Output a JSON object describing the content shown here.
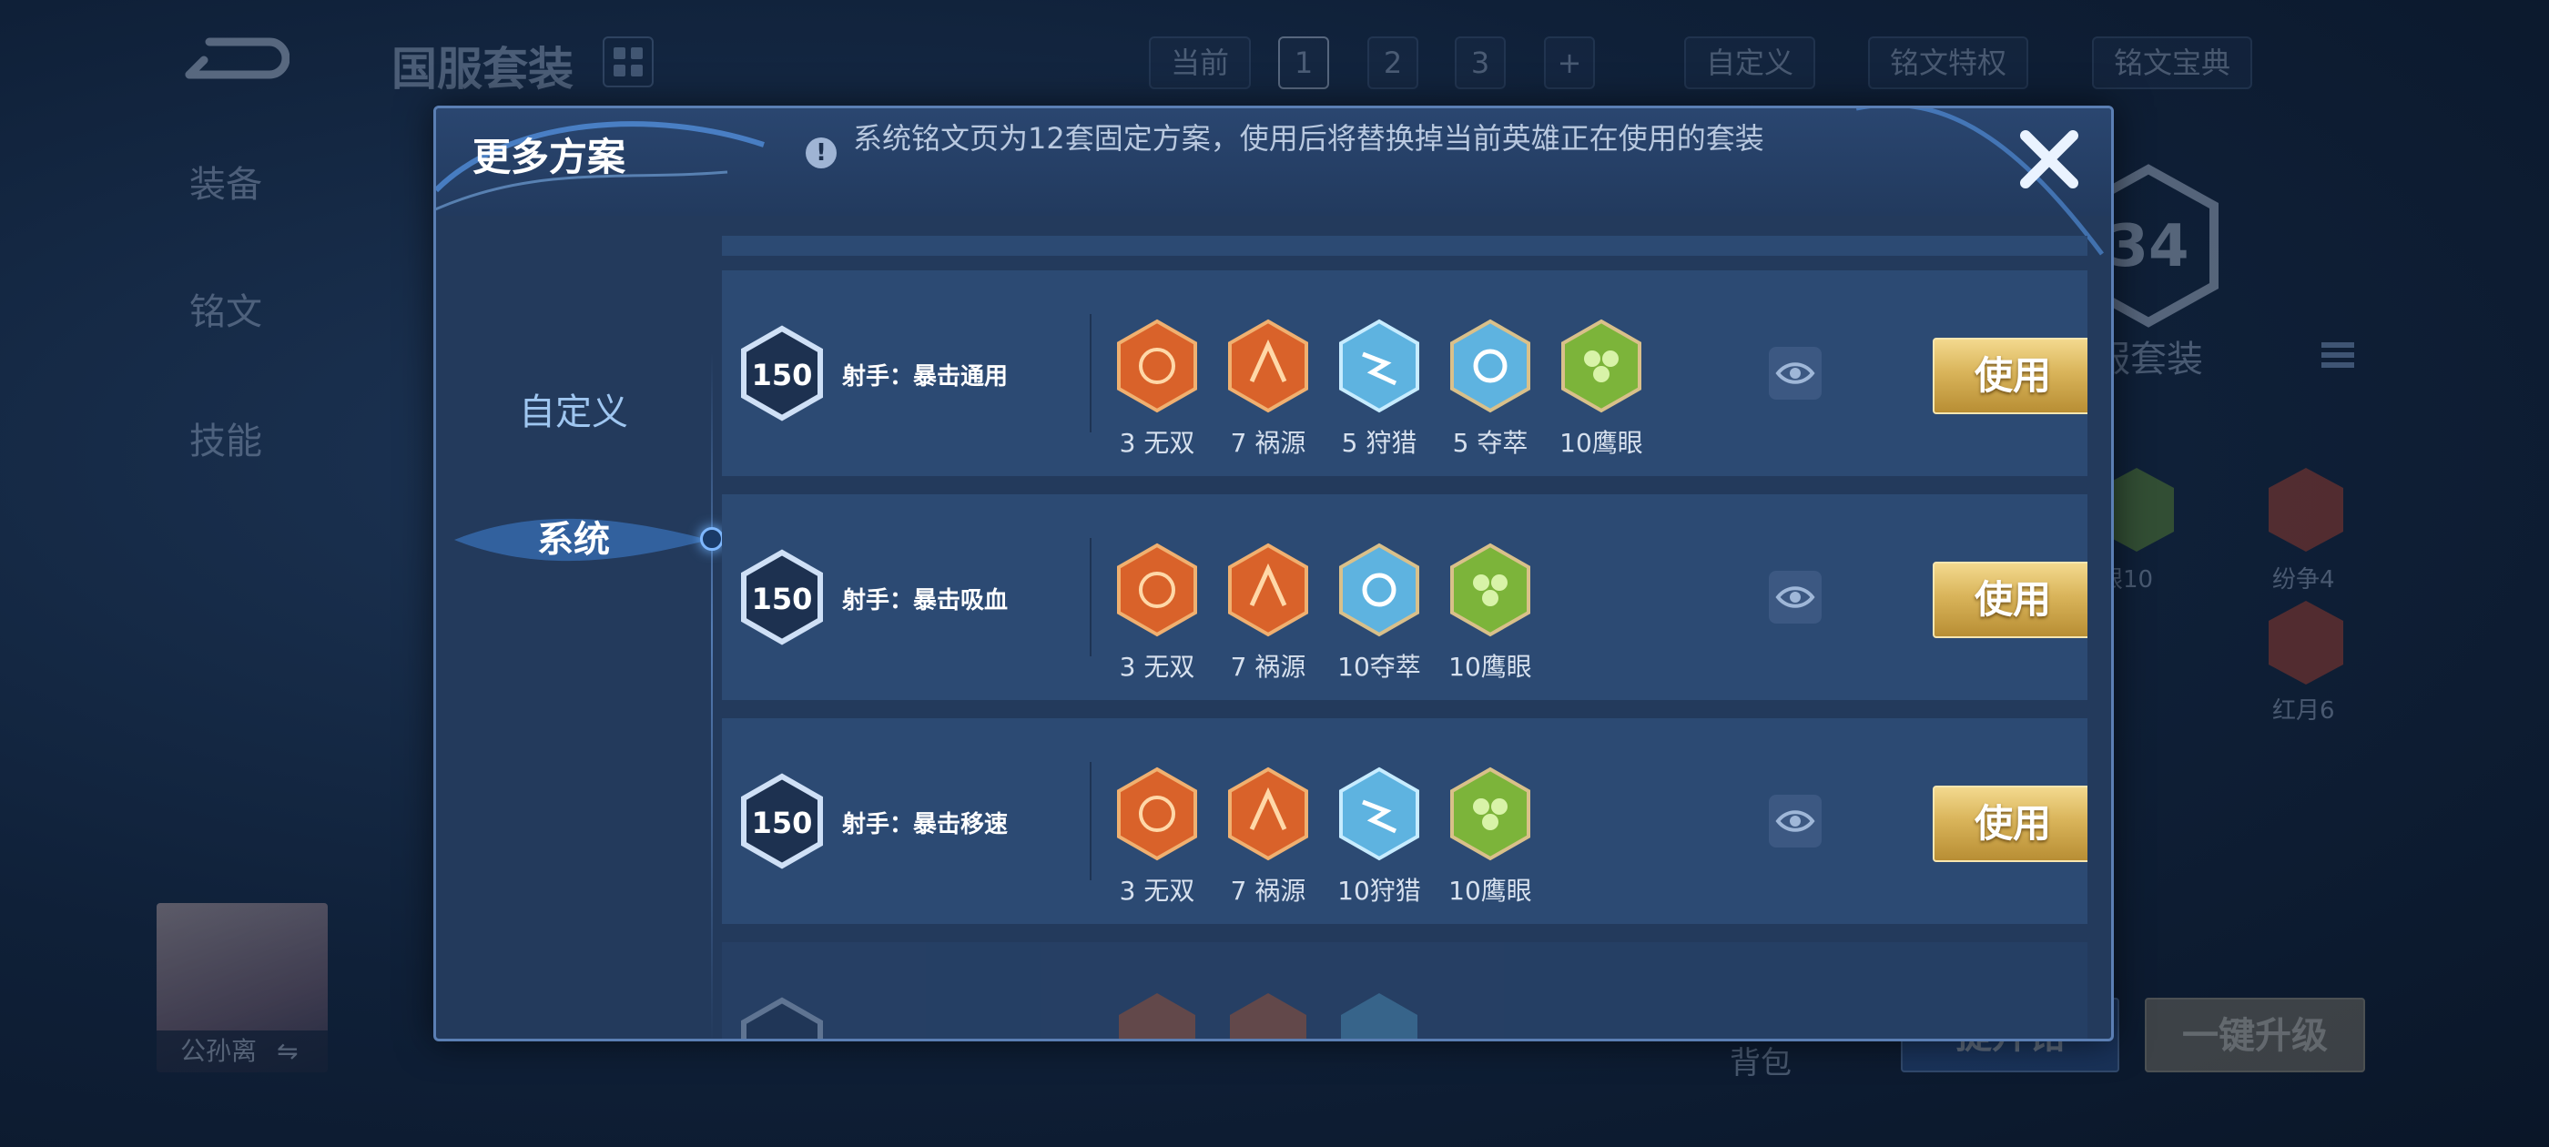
{
  "background": {
    "title": "国服套装",
    "nav": {
      "equip": "装备",
      "rune": "铭文",
      "skill": "技能"
    },
    "top_bar": {
      "current": "当前",
      "pages": [
        "1",
        "2",
        "3"
      ],
      "add": "+",
      "custom": "自定义",
      "privilege": "铭文特权",
      "codex": "铭文宝典"
    },
    "badge_number": "34",
    "big_label": "服套装",
    "side_runes": [
      "眼10",
      "纷争4",
      "红月6"
    ],
    "hero_name": "公孙离",
    "bag": "背包",
    "upgrade_runes_btn": "提升铭",
    "one_click_btn": "一键升级"
  },
  "modal": {
    "title": "更多方案",
    "notice": "系统铭文页为12套固定方案，使用后将替换掉当前英雄正在使用的套装",
    "tabs": {
      "custom": "自定义",
      "system": "系统"
    },
    "plans": [
      {
        "level": "150",
        "name": "射手：暴击通用",
        "runes": [
          {
            "label": "3 无双",
            "color": "#d9622a",
            "icon": "wushuang-rune-icon"
          },
          {
            "label": "7 祸源",
            "color": "#d9622a",
            "icon": "huoyuan-rune-icon"
          },
          {
            "label": "5 狩猎",
            "color": "#5eb3e0",
            "icon": "shoulie-rune-icon"
          },
          {
            "label": "5 夺萃",
            "color": "#5eb3e0",
            "icon": "duocui-rune-icon"
          },
          {
            "label": "10鹰眼",
            "color": "#7cb43a",
            "icon": "yingyan-rune-icon"
          }
        ],
        "use": "使用"
      },
      {
        "level": "150",
        "name": "射手：暴击吸血",
        "runes": [
          {
            "label": "3 无双",
            "color": "#d9622a",
            "icon": "wushuang-rune-icon"
          },
          {
            "label": "7 祸源",
            "color": "#d9622a",
            "icon": "huoyuan-rune-icon"
          },
          {
            "label": "10夺萃",
            "color": "#5eb3e0",
            "icon": "duocui-rune-icon"
          },
          {
            "label": "10鹰眼",
            "color": "#7cb43a",
            "icon": "yingyan-rune-icon"
          }
        ],
        "use": "使用"
      },
      {
        "level": "150",
        "name": "射手：暴击移速",
        "runes": [
          {
            "label": "3 无双",
            "color": "#d9622a",
            "icon": "wushuang-rune-icon"
          },
          {
            "label": "7 祸源",
            "color": "#d9622a",
            "icon": "huoyuan-rune-icon"
          },
          {
            "label": "10狩猎",
            "color": "#5eb3e0",
            "icon": "shoulie-rune-icon"
          },
          {
            "label": "10鹰眼",
            "color": "#7cb43a",
            "icon": "yingyan-rune-icon"
          }
        ],
        "use": "使用"
      }
    ]
  }
}
